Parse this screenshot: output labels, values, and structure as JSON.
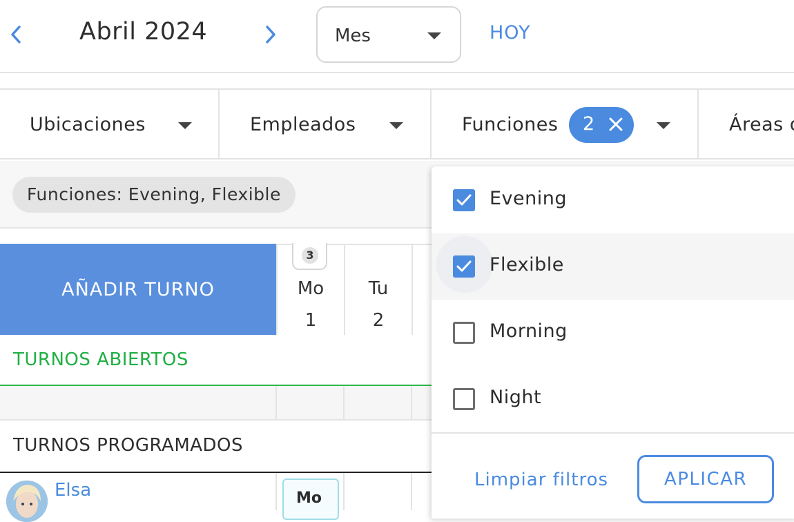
{
  "header": {
    "month_title": "Abril 2024",
    "view_select": {
      "selected": "Mes"
    },
    "today_label": "HOY"
  },
  "filters": {
    "items": [
      {
        "label": "Ubicaciones"
      },
      {
        "label": "Empleados"
      },
      {
        "label": "Funciones",
        "badge_count": "2"
      },
      {
        "label": "Áreas d"
      }
    ],
    "active_chip": "Funciones: Evening, Flexible"
  },
  "calendar": {
    "add_shift_label": "AÑADIR TURNO",
    "days": [
      {
        "name": "Mo",
        "date": "1",
        "badge": "3"
      },
      {
        "name": "Tu",
        "date": "2"
      }
    ],
    "open_shifts_title": "TURNOS ABIERTOS",
    "scheduled_shifts_title": "TURNOS PROGRAMADOS",
    "employees": [
      {
        "name": "Elsa",
        "shift_label": "Mo"
      }
    ]
  },
  "dropdown": {
    "options": [
      {
        "label": "Evening",
        "checked": true
      },
      {
        "label": "Flexible",
        "checked": true
      },
      {
        "label": "Morning",
        "checked": false
      },
      {
        "label": "Night",
        "checked": false
      }
    ],
    "clear_label": "Limpiar filtros",
    "apply_label": "APLICAR"
  },
  "colors": {
    "accent": "#4a8be0",
    "add_shift_bg": "#5a8fde",
    "open_shifts": "#1fb043"
  },
  "icons": [
    "chevron-left-icon",
    "chevron-right-icon",
    "caret-down-icon",
    "close-icon",
    "check-icon"
  ]
}
